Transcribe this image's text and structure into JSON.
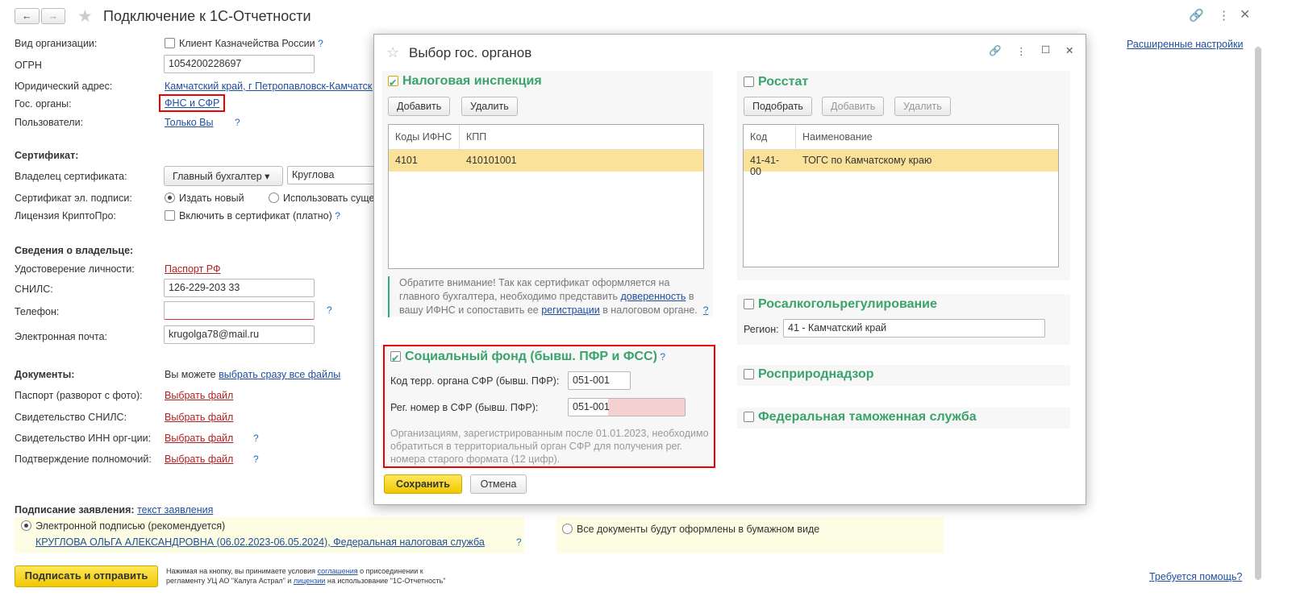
{
  "window": {
    "title": "Подключение к 1С-Отчетности",
    "advanced": "Расширенные настройки",
    "help": "Требуется помощь?"
  },
  "form": {
    "org_type_label": "Вид организации:",
    "treasury_client": "Клиент Казначейства России",
    "ogrn_label": "ОГРН",
    "ogrn": "1054200228697",
    "address_label": "Юридический адрес:",
    "address": "Камчатский край, г Петропавловск-Камчатский",
    "gov_label": "Гос. органы:",
    "gov": "ФНС и СФР",
    "users_label": "Пользователи:",
    "users": "Только Вы",
    "cert_head": "Сертификат:",
    "owner_label": "Владелец сертификата:",
    "owner_role": "Главный бухгалтер",
    "owner_name": "Круглова",
    "sig_label": "Сертификат эл. подписи:",
    "sig_new": "Издать новый",
    "sig_existing": "Использовать существующий",
    "crypto_label": "Лицензия КриптоПро:",
    "crypto": "Включить в сертификат (платно)",
    "owner_head": "Сведения о владельце:",
    "id_label": "Удостоверение личности:",
    "id": "Паспорт РФ",
    "snils_label": "СНИЛС:",
    "snils": "126-229-203 33",
    "phone_label": "Телефон:",
    "phone": "",
    "email_label": "Электронная почта:",
    "email": "krugolga78@mail.ru",
    "docs_head": "Документы:",
    "docs_hint": "Вы можете",
    "docs_all": "выбрать сразу все файлы",
    "docs": [
      {
        "label": "Паспорт (разворот с фото):",
        "link": "Выбрать файл"
      },
      {
        "label": "Свидетельство СНИЛС:",
        "link": "Выбрать файл"
      },
      {
        "label": "Свидетельство ИНН орг-ции:",
        "link": "Выбрать файл"
      },
      {
        "label": "Подтверждение полномочий:",
        "link": "Выбрать файл"
      }
    ],
    "signing_label": "Подписание заявления:",
    "signing_link": "текст заявления",
    "esign": "Электронной подписью (рекомендуется)",
    "esign_cert": "КРУГЛОВА ОЛЬГА АЛЕКСАНДРОВНА (06.02.2023-06.05.2024), Федеральная налоговая служба",
    "paper": "Все документы будут оформлены в бумажном виде",
    "submit": "Подписать и отправить",
    "terms": [
      "Нажимая на кнопку, вы принимаете условия",
      "соглашения",
      "о присоединении к",
      "регламенту УЦ АО \"Калуга Астрал\" и",
      "лицензии",
      "на использование \"1С-Отчетность\""
    ],
    "q": "?"
  },
  "dialog": {
    "title": "Выбор гос. органов",
    "tax": {
      "title": "Налоговая инспекция",
      "add": "Добавить",
      "del": "Удалить",
      "cols": [
        "Коды ИФНС",
        "КПП"
      ],
      "rows": [
        [
          "4101",
          "410101001"
        ]
      ],
      "note": [
        "Обратите внимание! Так как сертификат оформляется на главного бухгалтера, необходимо представить",
        "доверенность",
        "в вашу ИФНС и сопоставить ее",
        "регистрации",
        "в налоговом органе."
      ]
    },
    "sfr": {
      "title": "Социальный фонд (бывш. ПФР и ФСС)",
      "code_label": "Код терр. органа СФР (бывш. ПФР):",
      "code": "051-001",
      "reg_label": "Рег. номер в СФР (бывш. ПФР):",
      "reg": "051-001",
      "note": "Организациям, зарегистрированным после 01.01.2023, необходимо обратиться в территориальный орган СФР для получения рег. номера старого формата (12 цифр)."
    },
    "rosstat": {
      "title": "Росстат",
      "pick": "Подобрать",
      "add": "Добавить",
      "del": "Удалить",
      "cols": [
        "Код",
        "Наименование"
      ],
      "rows": [
        [
          "41-41-00",
          "ТОГС по Камчатскому краю"
        ]
      ]
    },
    "alco": {
      "title": "Росалкогольрегулирование",
      "region_label": "Регион:",
      "region": "41 - Камчатский край"
    },
    "nature": {
      "title": "Росприроднадзор"
    },
    "customs": {
      "title": "Федеральная таможенная служба"
    },
    "save": "Сохранить",
    "cancel": "Отмена"
  }
}
